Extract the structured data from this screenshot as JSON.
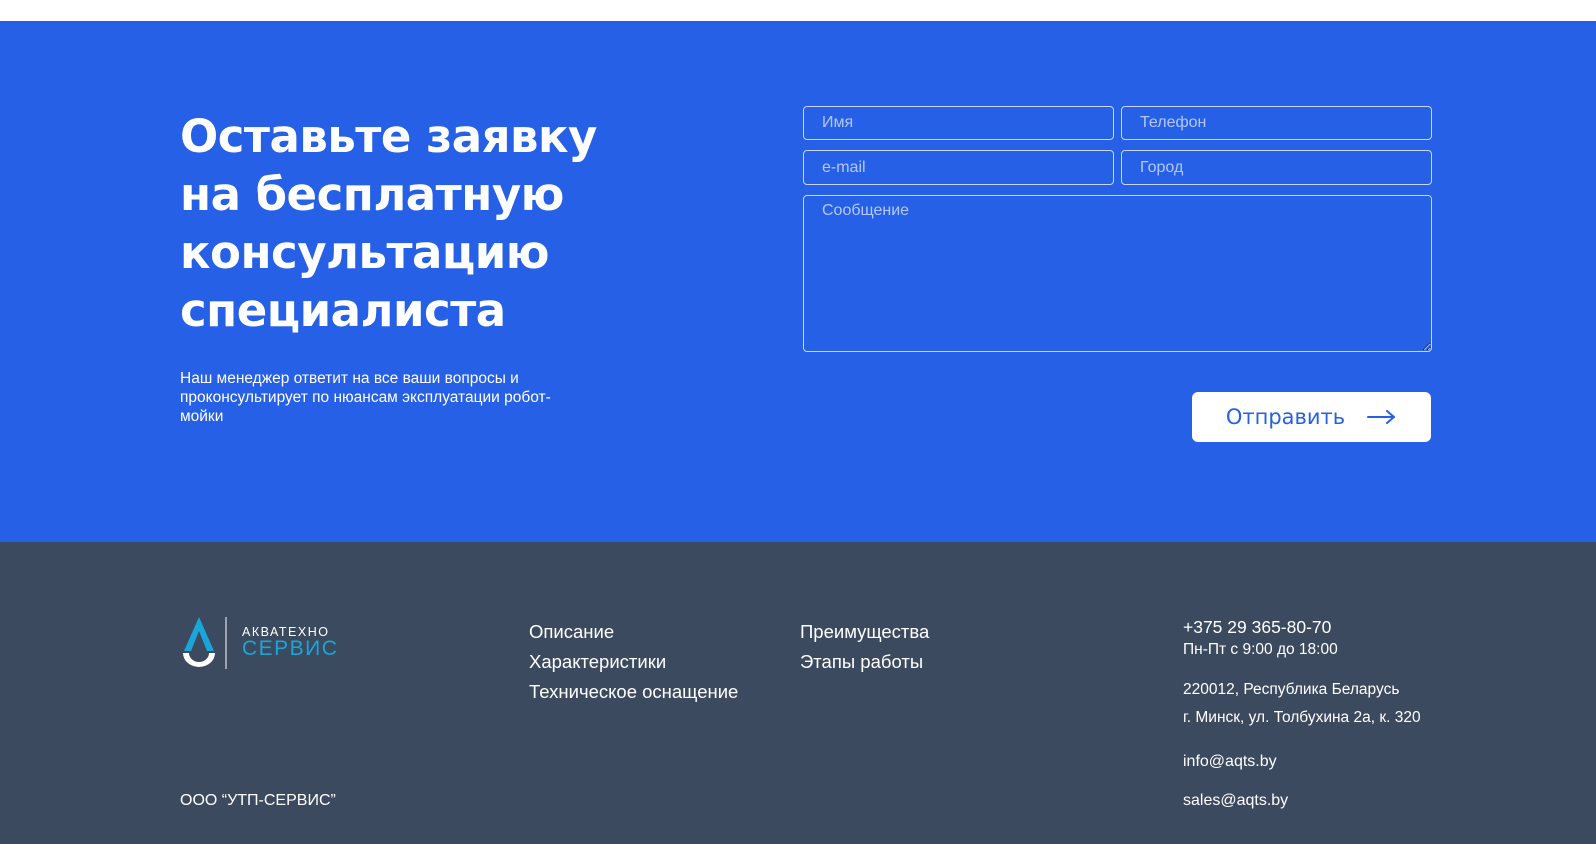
{
  "cta": {
    "title_lines": [
      "Оставьте заявку",
      "на бесплатную",
      "консультацию",
      "специалиста"
    ],
    "subtitle": "Наш менеджер ответит на все ваши вопросы и проконсультирует по нюансам эксплуатации робот-мойки",
    "form": {
      "name_placeholder": "Имя",
      "phone_placeholder": "Телефон",
      "email_placeholder": "e-mail",
      "city_placeholder": "Город",
      "message_placeholder": "Сообщение",
      "submit_label": "Отправить"
    },
    "background_color": "#2660E6"
  },
  "footer": {
    "logo": {
      "line1": "АКВАТЕХНО",
      "line2": "СЕРВИС",
      "icon": "water-drop-a-logo-icon"
    },
    "nav_col1": [
      "Описание",
      "Характеристики",
      "Техническое оснащение"
    ],
    "nav_col2": [
      "Преимущества",
      "Этапы работы"
    ],
    "contacts": {
      "phone": "+375 29 365-80-70",
      "hours": "Пн-Пт с 9:00 до 18:00",
      "address_line1": "220012, Республика Беларусь",
      "address_line2": "г. Минск, ул. Толбухина 2а, к. 320",
      "email_info": "info@aqts.by",
      "email_sales": "sales@aqts.by"
    },
    "company": "ООО “УТП-СЕРВИС”",
    "background_color": "#3C4A5F",
    "accent_color": "#19A6D8"
  }
}
